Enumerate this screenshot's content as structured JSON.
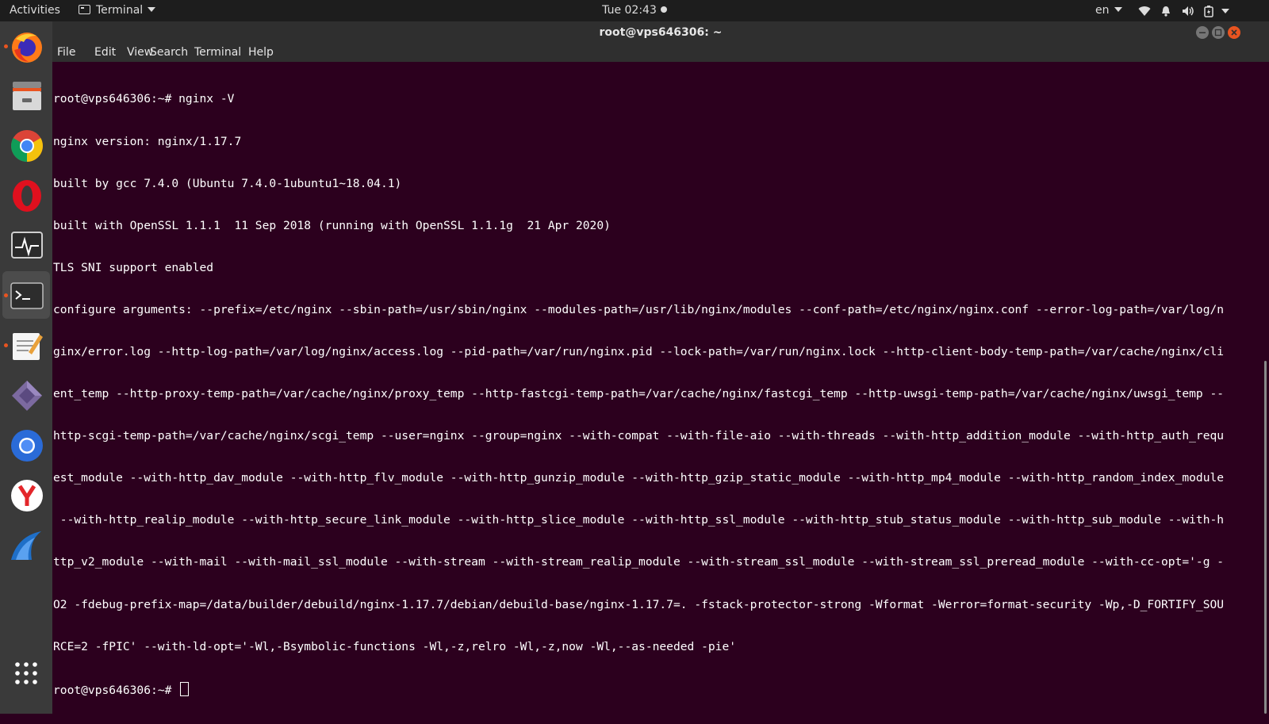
{
  "topbar": {
    "activities": "Activities",
    "app_menu": "Terminal",
    "clock": "Tue 02:43",
    "language": "en",
    "tray_icons": [
      "wifi-icon",
      "notification-bell-icon",
      "volume-icon",
      "battery-icon",
      "system-menu-caret-icon"
    ]
  },
  "dock": {
    "apps": [
      {
        "name": "firefox",
        "running": true
      },
      {
        "name": "files",
        "running": false
      },
      {
        "name": "google-chrome",
        "running": false
      },
      {
        "name": "opera",
        "running": false
      },
      {
        "name": "system-monitor",
        "running": false
      },
      {
        "name": "terminal",
        "running": true,
        "active": true
      },
      {
        "name": "text-editor",
        "running": true
      },
      {
        "name": "app-diamond",
        "running": false
      },
      {
        "name": "chromium",
        "running": false
      },
      {
        "name": "yandex-browser",
        "running": false
      },
      {
        "name": "wireshark",
        "running": false
      }
    ],
    "show_apps_icon": "grid-icon"
  },
  "window": {
    "title": "root@vps646306: ~",
    "menu": [
      "File",
      "Edit",
      "View",
      "Search",
      "Terminal",
      "Help"
    ]
  },
  "terminal": {
    "lines": [
      "root@vps646306:~# nginx -V",
      "nginx version: nginx/1.17.7",
      "built by gcc 7.4.0 (Ubuntu 7.4.0-1ubuntu1~18.04.1)",
      "built with OpenSSL 1.1.1  11 Sep 2018 (running with OpenSSL 1.1.1g  21 Apr 2020)",
      "TLS SNI support enabled",
      "configure arguments: --prefix=/etc/nginx --sbin-path=/usr/sbin/nginx --modules-path=/usr/lib/nginx/modules --conf-path=/etc/nginx/nginx.conf --error-log-path=/var/log/n",
      "ginx/error.log --http-log-path=/var/log/nginx/access.log --pid-path=/var/run/nginx.pid --lock-path=/var/run/nginx.lock --http-client-body-temp-path=/var/cache/nginx/cli",
      "ent_temp --http-proxy-temp-path=/var/cache/nginx/proxy_temp --http-fastcgi-temp-path=/var/cache/nginx/fastcgi_temp --http-uwsgi-temp-path=/var/cache/nginx/uwsgi_temp --",
      "http-scgi-temp-path=/var/cache/nginx/scgi_temp --user=nginx --group=nginx --with-compat --with-file-aio --with-threads --with-http_addition_module --with-http_auth_requ",
      "est_module --with-http_dav_module --with-http_flv_module --with-http_gunzip_module --with-http_gzip_static_module --with-http_mp4_module --with-http_random_index_module",
      " --with-http_realip_module --with-http_secure_link_module --with-http_slice_module --with-http_ssl_module --with-http_stub_status_module --with-http_sub_module --with-h",
      "ttp_v2_module --with-mail --with-mail_ssl_module --with-stream --with-stream_realip_module --with-stream_ssl_module --with-stream_ssl_preread_module --with-cc-opt='-g -",
      "O2 -fdebug-prefix-map=/data/builder/debuild/nginx-1.17.7/debian/debuild-base/nginx-1.17.7=. -fstack-protector-strong -Wformat -Werror=format-security -Wp,-D_FORTIFY_SOU",
      "RCE=2 -fPIC' --with-ld-opt='-Wl,-Bsymbolic-functions -Wl,-z,relro -Wl,-z,now -Wl,--as-needed -pie'"
    ],
    "prompt": "root@vps646306:~# "
  },
  "colors": {
    "terminal_bg": "#2c001e",
    "accent": "#e95420"
  }
}
